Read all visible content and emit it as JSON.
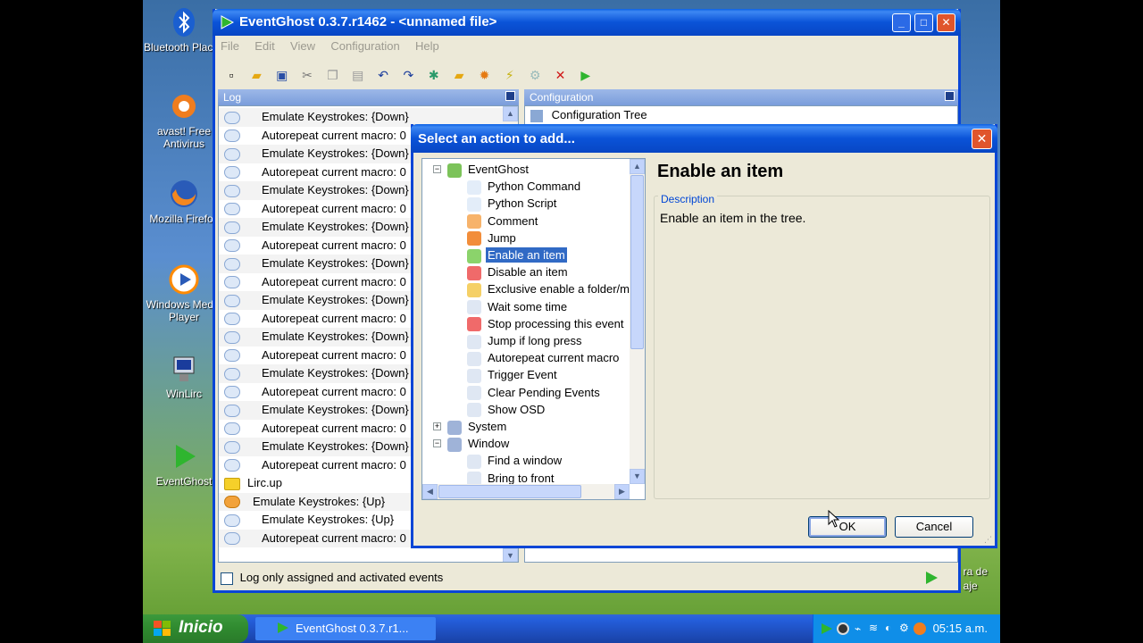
{
  "desktop": {
    "icons": [
      {
        "label": "Bluetooth Places",
        "icon": "bluetooth-icon"
      },
      {
        "label": "avast! Free Antivirus",
        "icon": "avast-icon"
      },
      {
        "label": "Mozilla Firefox",
        "icon": "firefox-icon"
      },
      {
        "label": "Windows Media Player",
        "icon": "media-player-icon"
      },
      {
        "label": "WinLirc",
        "icon": "winlirc-icon"
      },
      {
        "label": "EventGhost",
        "icon": "eventghost-icon"
      }
    ],
    "right_label": "ra de\naje"
  },
  "main_window": {
    "title": "EventGhost 0.3.7.r1462 - <unnamed file>",
    "menu": [
      "File",
      "Edit",
      "View",
      "Configuration",
      "Help"
    ],
    "log_header": "Log",
    "config_header": "Configuration",
    "config_root": "Configuration Tree",
    "log_rows": [
      "Emulate Keystrokes: {Down}",
      "Autorepeat current macro: 0",
      "Emulate Keystrokes: {Down}",
      "Autorepeat current macro: 0",
      "Emulate Keystrokes: {Down}",
      "Autorepeat current macro: 0",
      "Emulate Keystrokes: {Down}",
      "Autorepeat current macro: 0",
      "Emulate Keystrokes: {Down}",
      "Autorepeat current macro: 0",
      "Emulate Keystrokes: {Down}",
      "Autorepeat current macro: 0",
      "Emulate Keystrokes: {Down}",
      "Autorepeat current macro: 0",
      "Emulate Keystrokes: {Down}",
      "Autorepeat current macro: 0",
      "Emulate Keystrokes: {Down}",
      "Autorepeat current macro: 0",
      "Emulate Keystrokes: {Down}",
      "Autorepeat current macro: 0"
    ],
    "log_tail": [
      {
        "text": "Lirc.up",
        "kind": "event"
      },
      {
        "text": "Emulate Keystrokes: {Up}",
        "kind": "macro"
      },
      {
        "text": "Emulate Keystrokes: {Up}",
        "kind": "action"
      },
      {
        "text": "Autorepeat current macro: 0",
        "kind": "action"
      }
    ],
    "status_checkbox": "Log only assigned and activated events"
  },
  "dialog": {
    "title": "Select an action to add...",
    "tree": {
      "root": "EventGhost",
      "items": [
        "Python Command",
        "Python Script",
        "Comment",
        "Jump",
        "Enable an item",
        "Disable an item",
        "Exclusive enable a folder/m",
        "Wait some time",
        "Stop processing this event",
        "Jump if long press",
        "Autorepeat current macro",
        "Trigger Event",
        "Clear Pending Events",
        "Show OSD"
      ],
      "selected_index": 4,
      "groups": [
        "System",
        "Window"
      ],
      "window_items": [
        "Find a window",
        "Bring to front"
      ]
    },
    "detail_title": "Enable an item",
    "description_label": "Description",
    "description_text": "Enable an item in the tree.",
    "ok_label": "OK",
    "cancel_label": "Cancel"
  },
  "taskbar": {
    "start_label": "Inicio",
    "task_label": "EventGhost 0.3.7.r1...",
    "clock": "05:15 a.m."
  }
}
